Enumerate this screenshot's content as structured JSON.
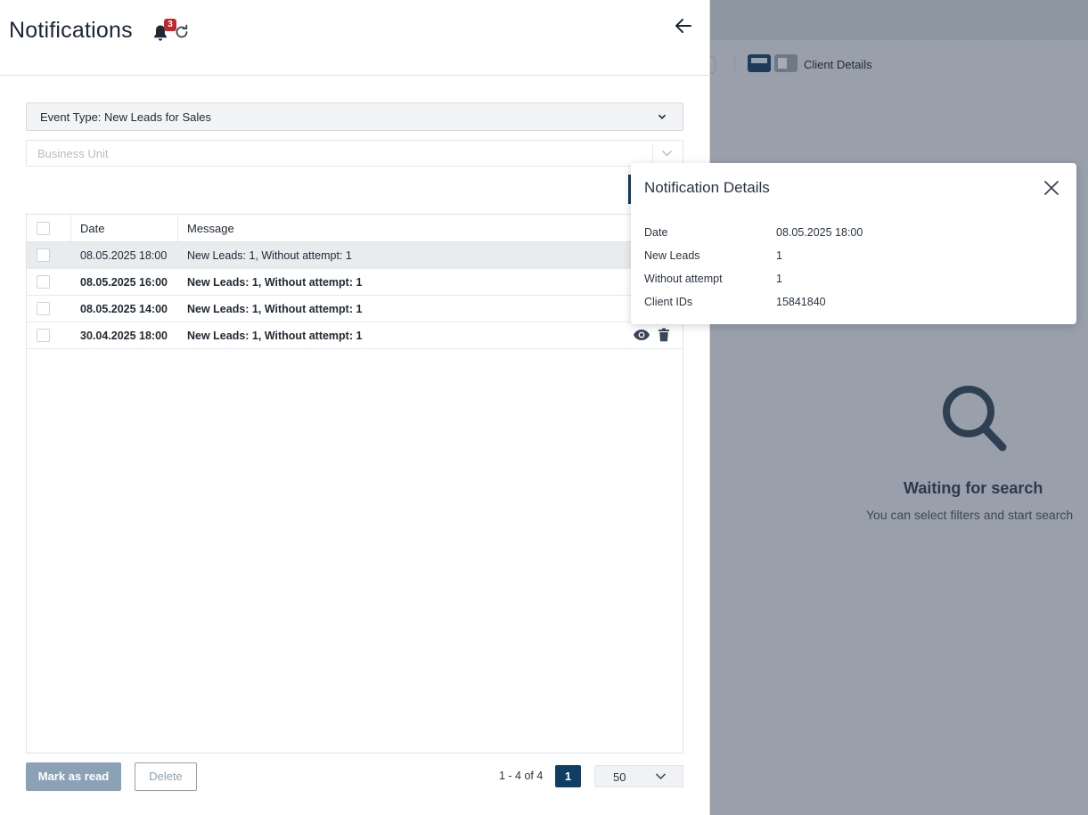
{
  "panel": {
    "title": "Notifications",
    "bell_badge": "3"
  },
  "filters": {
    "event_type": "Event Type: New Leads for Sales",
    "business_unit_placeholder": "Business Unit"
  },
  "table": {
    "headers": {
      "date": "Date",
      "message": "Message"
    },
    "rows": [
      {
        "date": "08.05.2025 18:00",
        "message": "New Leads: 1, Without attempt: 1"
      },
      {
        "date": "08.05.2025 16:00",
        "message": "New Leads: 1, Without attempt: 1"
      },
      {
        "date": "08.05.2025 14:00",
        "message": "New Leads: 1, Without attempt: 1"
      },
      {
        "date": "30.04.2025 18:00",
        "message": "New Leads: 1, Without attempt: 1"
      }
    ]
  },
  "footer": {
    "mark_as_read": "Mark as read",
    "delete": "Delete",
    "range": "1 - 4 of 4",
    "current_page": "1",
    "page_size": "50"
  },
  "popup": {
    "title": "Notification Details",
    "fields": [
      {
        "label": "Date",
        "value": "08.05.2025 18:00"
      },
      {
        "label": "New Leads",
        "value": "1"
      },
      {
        "label": "Without attempt",
        "value": "1"
      },
      {
        "label": "Client IDs",
        "value": "15841840"
      }
    ]
  },
  "background": {
    "client_details": "Client Details",
    "empty_title": "Waiting for search",
    "empty_subtitle": "You can select filters and start search"
  },
  "colors": {
    "primary": "#0f3d63",
    "badge": "#c1272d",
    "overlay": "#99a0ab"
  }
}
